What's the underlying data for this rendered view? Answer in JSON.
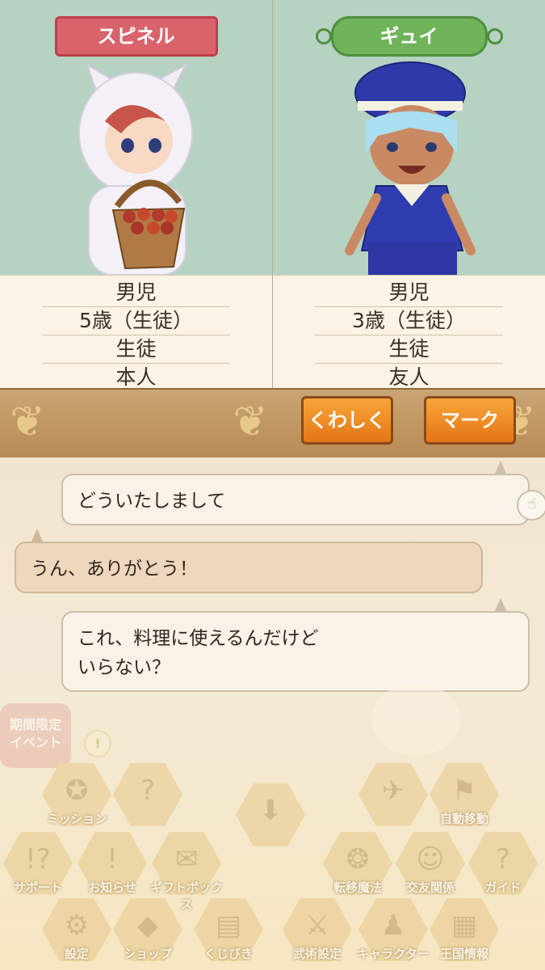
{
  "characters": [
    {
      "name": "スピネル",
      "info": [
        "男児",
        "5歳（生徒）",
        "生徒",
        "本人"
      ]
    },
    {
      "name": "ギュイ",
      "info": [
        "男児",
        "3歳（生徒）",
        "生徒",
        "友人"
      ]
    }
  ],
  "buttons": {
    "details": "くわしく",
    "mark": "マーク"
  },
  "messages": [
    {
      "side": "them",
      "text": "どういたしまして"
    },
    {
      "side": "me",
      "text": "うん、ありがとう！"
    },
    {
      "side": "them",
      "text": "これ、料理に使えるんだけど\nいらない？"
    }
  ],
  "hud": {
    "event_badge": "期間限定\nイベント",
    "items": [
      {
        "label": "ミッション",
        "icon": "mission-icon"
      },
      {
        "label": "",
        "icon": "help-icon"
      },
      {
        "label": "",
        "icon": "down-arrow-icon"
      },
      {
        "label": "",
        "icon": "map-icon"
      },
      {
        "label": "自動移動",
        "icon": "auto-move-icon"
      },
      {
        "label": "サポート",
        "icon": "support-icon"
      },
      {
        "label": "お知らせ",
        "icon": "notice-icon"
      },
      {
        "label": "ギフトボックス",
        "icon": "giftbox-icon"
      },
      {
        "label": "転移魔法",
        "icon": "teleport-icon"
      },
      {
        "label": "交友関係",
        "icon": "friends-icon"
      },
      {
        "label": "ガイド",
        "icon": "guide-icon"
      },
      {
        "label": "設定",
        "icon": "settings-icon"
      },
      {
        "label": "ショップ",
        "icon": "shop-icon"
      },
      {
        "label": "くじびき",
        "icon": "lottery-icon"
      },
      {
        "label": "武術設定",
        "icon": "martial-icon"
      },
      {
        "label": "キャラクター",
        "icon": "character-icon"
      },
      {
        "label": "王国情報",
        "icon": "kingdom-icon"
      }
    ]
  }
}
